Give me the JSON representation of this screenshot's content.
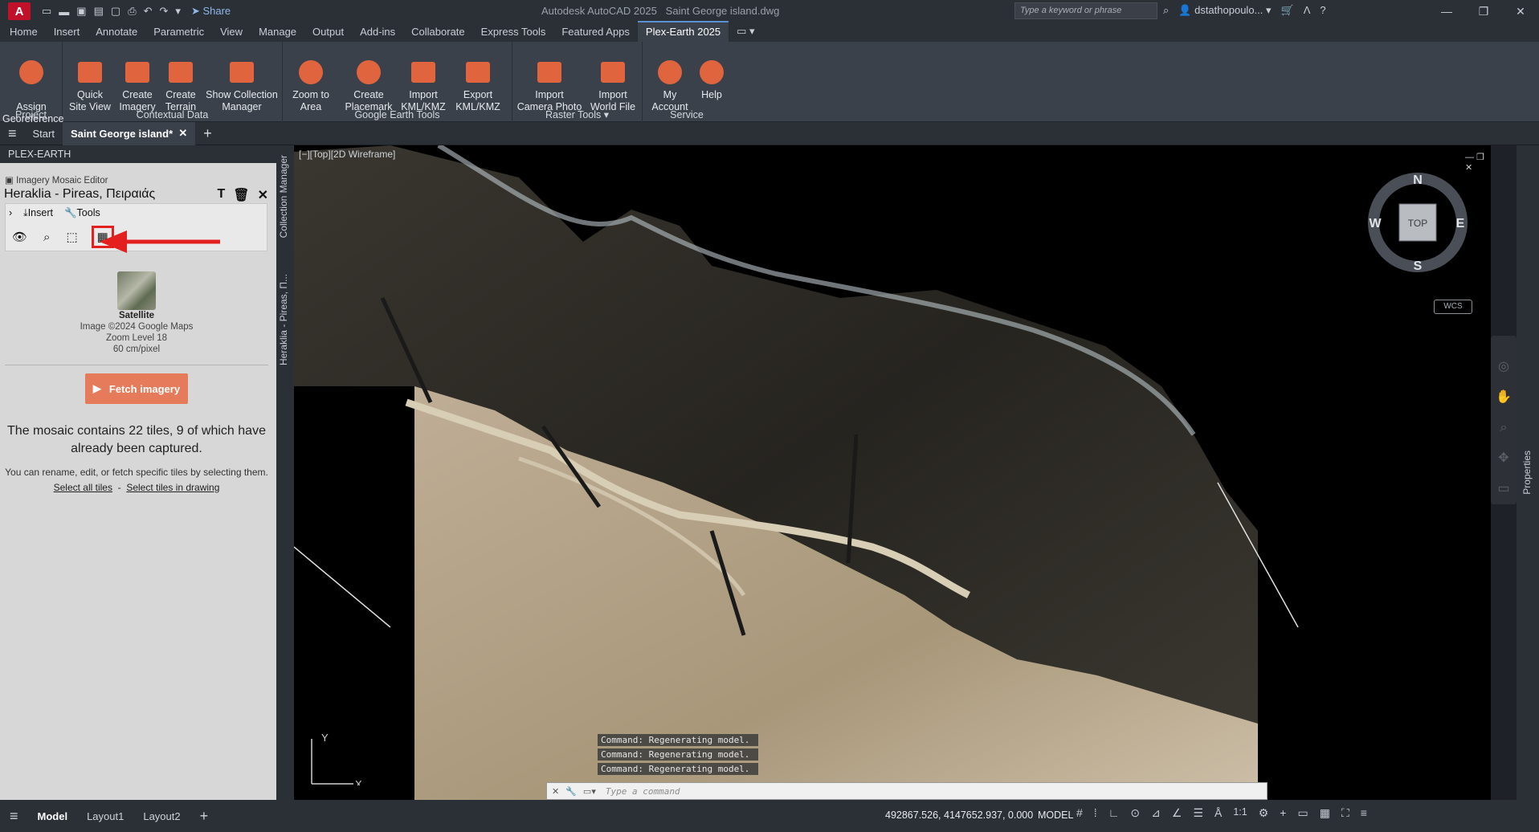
{
  "titlebar": {
    "app_icon": "A",
    "share_label": "Share",
    "app_title": "Autodesk AutoCAD 2025",
    "doc_title": "Saint George island.dwg",
    "search_placeholder": "Type a keyword or phrase",
    "user_name": "dstathopoulo..."
  },
  "menu": {
    "tabs": [
      "Home",
      "Insert",
      "Annotate",
      "Parametric",
      "View",
      "Manage",
      "Output",
      "Add-ins",
      "Collaborate",
      "Express Tools",
      "Featured Apps",
      "Plex-Earth 2025"
    ]
  },
  "ribbon": {
    "project": {
      "label": "Project",
      "btn1": "Assign\nGeoreference"
    },
    "contextual": {
      "label": "Contextual Data",
      "btn1": "Quick\nSite View",
      "btn2": "Create\nImagery",
      "btn3": "Create\nTerrain",
      "btn4": "Show Collection\nManager"
    },
    "google": {
      "label": "Google Earth Tools",
      "btn1": "Zoom to\nArea",
      "btn2": "Create\nPlacemark",
      "btn3": "Import\nKML/KMZ",
      "btn4": "Export\nKML/KMZ"
    },
    "raster": {
      "label": "Raster Tools",
      "btn1": "Import\nCamera Photo",
      "btn2": "Import\nWorld File"
    },
    "service": {
      "label": "Service",
      "btn1": "My\nAccount",
      "btn2": "Help"
    }
  },
  "doctabs": {
    "start": "Start",
    "current": "Saint George island*"
  },
  "plex": {
    "header": "PLEX-EARTH",
    "editor_title": "Imagery Mosaic Editor",
    "mosaic_name": "Heraklia - Pireas, Πειραιάς",
    "insert": "Insert",
    "tools": "Tools",
    "sat_name": "Satellite",
    "sat_copyright": "Image ©2024 Google Maps",
    "sat_zoom": "Zoom Level 18",
    "sat_res": "60 cm/pixel",
    "fetch": "Fetch imagery",
    "mosaic_text": "The mosaic contains 22 tiles, 9 of which have already been captured.",
    "hint": "You can rename, edit, or fetch specific tiles by selecting them.",
    "select_all": "Select all tiles",
    "select_drawing": "Select tiles in drawing"
  },
  "vtabs": {
    "collection": "Collection Manager",
    "mosaic": "Heraklia - Pireas, Π..."
  },
  "viewport": {
    "label": "[−][Top][2D Wireframe]",
    "cube_top": "TOP",
    "n": "N",
    "s": "S",
    "e": "E",
    "w": "W",
    "wcs": "WCS"
  },
  "properties": "Properties",
  "commands": {
    "history": [
      "Command: Regenerating model.",
      "Command: Regenerating model.",
      "Command: Regenerating model."
    ],
    "placeholder": "Type a command"
  },
  "status": {
    "model_tab": "Model",
    "layout1": "Layout1",
    "layout2": "Layout2",
    "coords": "492867.526, 4147652.937, 0.000",
    "mode": "MODEL",
    "scale": "1:1"
  }
}
